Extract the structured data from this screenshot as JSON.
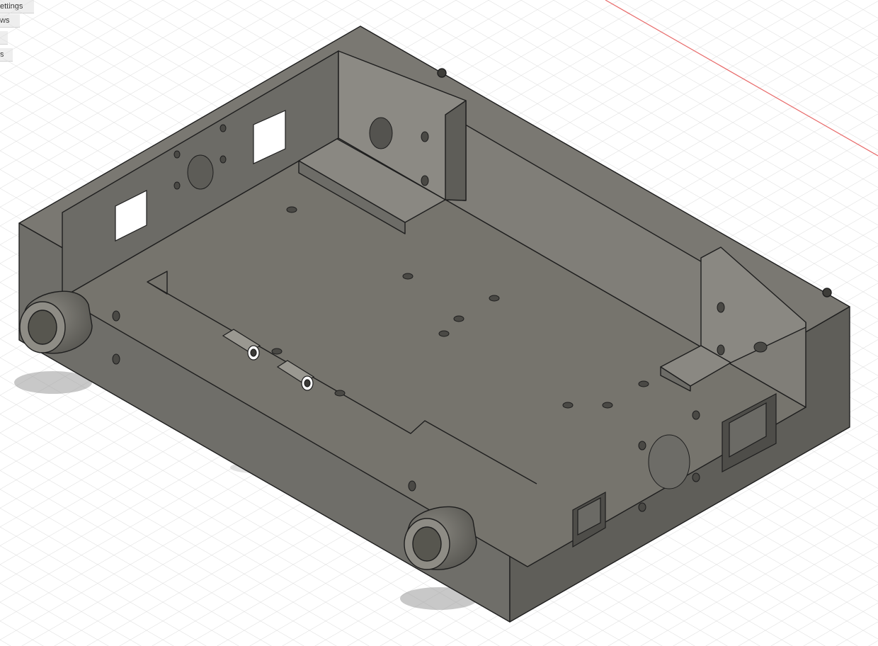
{
  "browser": {
    "items": [
      {
        "label": "ettings"
      },
      {
        "label": "ws"
      },
      {
        "label": ""
      },
      {
        "label": "s"
      }
    ]
  },
  "viewport": {
    "background": "#ffffff",
    "grid_color": "#d6d6d6",
    "axis_x_color": "#e86a6a",
    "model_top_color": "#7a7872",
    "model_left_color": "#6f6e69",
    "model_right_color": "#5f5e59",
    "model_floor_color": "#76746d",
    "edge_color": "#1e1e1e"
  }
}
